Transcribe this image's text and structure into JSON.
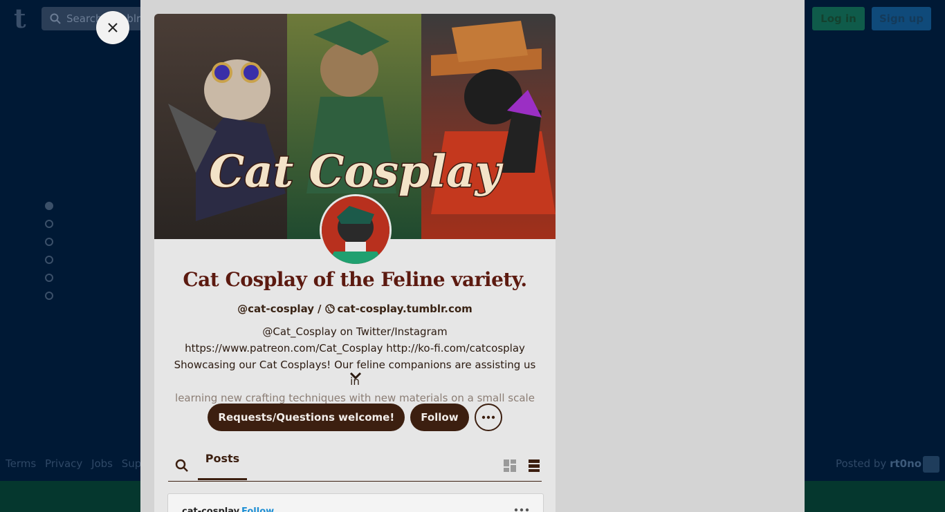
{
  "background": {
    "logo": "t",
    "search_placeholder": "Search Tumblr",
    "login_label": "Log in",
    "signup_label": "Sign up",
    "footer_links": [
      "Terms",
      "Privacy",
      "Jobs",
      "Supp"
    ],
    "posted_by_label": "Posted by",
    "posted_by_user": "rt0no",
    "carousel_dots": 6,
    "active_dot": 0
  },
  "modal": {
    "close_label": "×",
    "header_text": "Cat Cosplay",
    "blog_title": "Cat Cosplay of the Feline variety.",
    "handle": "@cat-cosplay",
    "handle_sep": "/",
    "blog_url": "cat-cosplay.tumblr.com",
    "description_lines": [
      "@Cat_Cosplay on Twitter/Instagram",
      "https://www.patreon.com/Cat_Cosplay http://ko-fi.com/catcosplay",
      "Showcasing our Cat Cosplays! Our feline companions are assisting us in",
      "learning new crafting techniques with new materials on a small scale for"
    ],
    "ask_button": "Requests/Questions welcome!",
    "follow_button": "Follow",
    "tabs": {
      "posts_label": "Posts"
    },
    "post_preview": {
      "username": "cat-cosplay",
      "follow_label": "Follow"
    },
    "colors": {
      "title": "#5c1a10",
      "button_bg": "#3c1f10",
      "link_blue": "#1e8fd4"
    }
  }
}
